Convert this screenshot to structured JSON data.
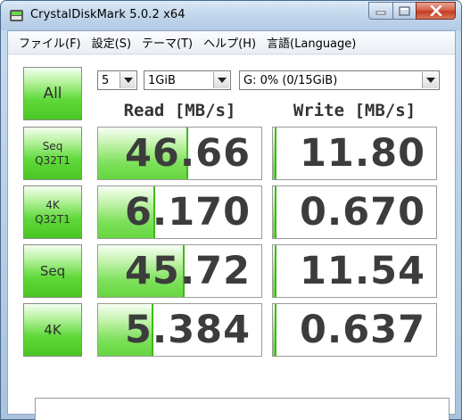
{
  "window": {
    "title": "CrystalDiskMark 5.0.2 x64"
  },
  "menu": [
    "ファイル(F)",
    "設定(S)",
    "テーマ(T)",
    "ヘルプ(H)",
    "言語(Language)"
  ],
  "controls": {
    "all_label": "All",
    "count": "5",
    "size": "1GiB",
    "drive": "G: 0% (0/15GiB)"
  },
  "columns": {
    "read": "Read [MB/s]",
    "write": "Write [MB/s]"
  },
  "rows": [
    {
      "label1": "Seq",
      "label2": "Q32T1",
      "read": "46.66",
      "write": "11.80",
      "read_fill": 0.55,
      "write_fill": 0.02
    },
    {
      "label1": "4K",
      "label2": "Q32T1",
      "read": "6.170",
      "write": "0.670",
      "read_fill": 0.35,
      "write_fill": 0.02
    },
    {
      "label1": "Seq",
      "label2": "",
      "read": "45.72",
      "write": "11.54",
      "read_fill": 0.53,
      "write_fill": 0.02
    },
    {
      "label1": "4K",
      "label2": "",
      "read": "5.384",
      "write": "0.637",
      "read_fill": 0.34,
      "write_fill": 0.02
    }
  ],
  "comment": "",
  "colors": {
    "button_green": "#5fd93a",
    "bar_green": "#7ee15c",
    "value_text": "#3c3c3c"
  }
}
